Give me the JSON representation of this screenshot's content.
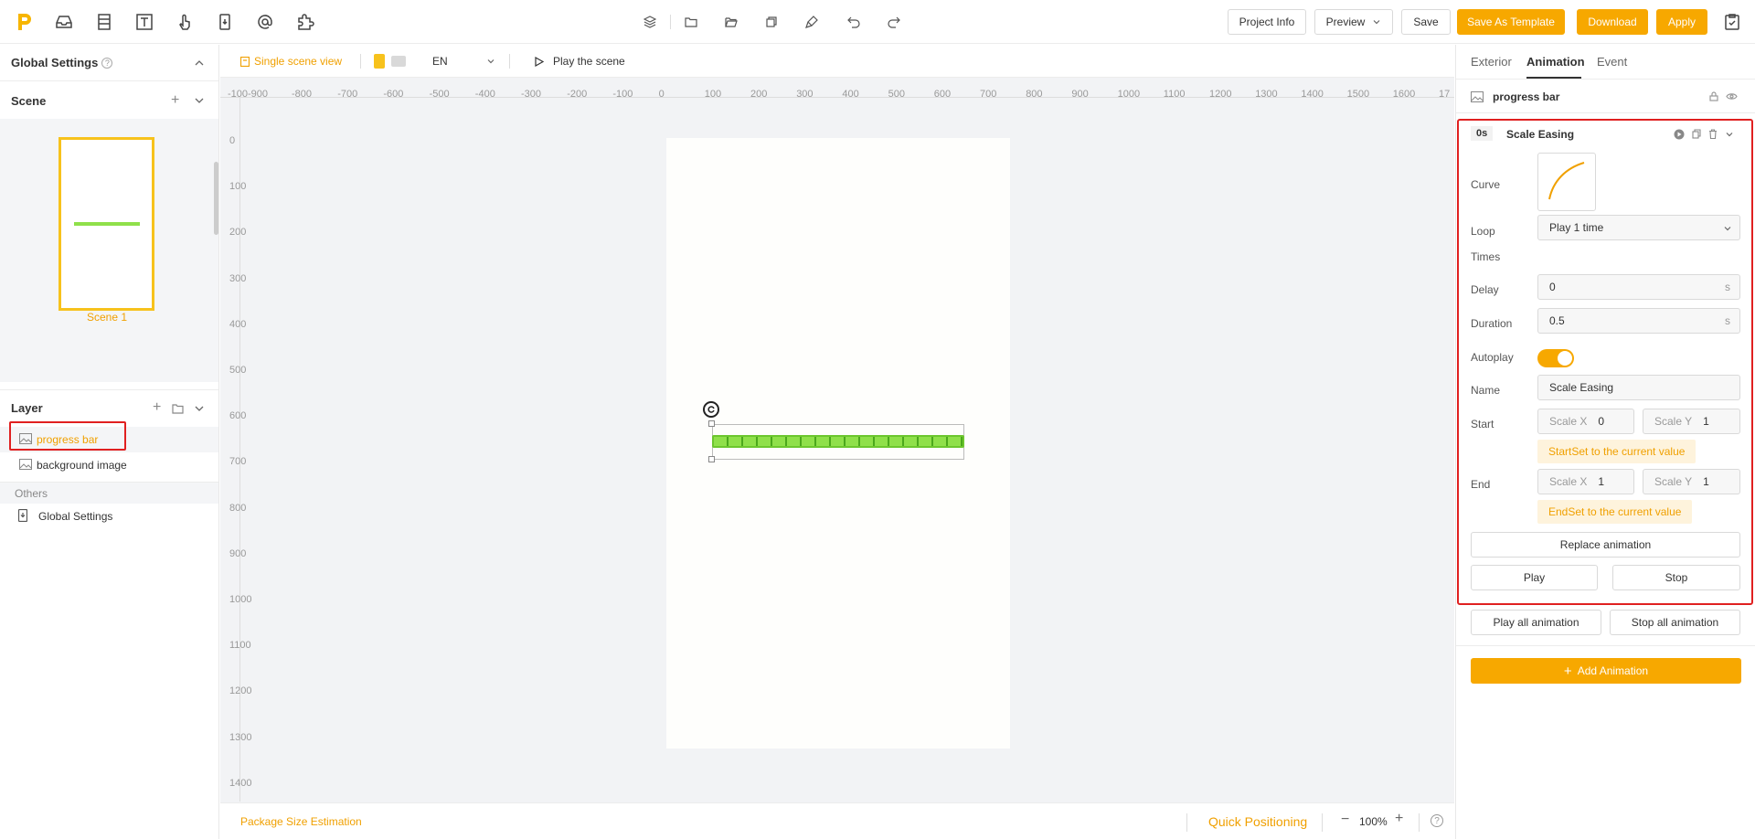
{
  "topbar": {
    "project_info": "Project Info",
    "preview": "Preview",
    "save": "Save",
    "save_template": "Save As Template",
    "download": "Download",
    "apply": "Apply"
  },
  "left": {
    "global_settings": "Global Settings",
    "scene_header": "Scene",
    "scene_name": "Scene 1",
    "layer_header": "Layer",
    "layers": [
      {
        "label": "progress bar",
        "selected": true
      },
      {
        "label": "background image",
        "selected": false
      }
    ],
    "others_header": "Others",
    "others_item": "Global Settings"
  },
  "canvas_toolbar": {
    "single_scene": "Single scene view",
    "language": "EN",
    "play_scene": "Play the scene"
  },
  "ruler": {
    "x_labels": [
      "-100",
      "-900",
      "-800",
      "-700",
      "-600",
      "-500",
      "-400",
      "-300",
      "-200",
      "-100",
      "0",
      "100",
      "200",
      "300",
      "400",
      "500",
      "600",
      "700",
      "800",
      "900",
      "1000",
      "1100",
      "1200",
      "1300",
      "1400",
      "1500",
      "1600",
      "17"
    ],
    "y_labels": [
      "0",
      "100",
      "200",
      "300",
      "400",
      "500",
      "600",
      "700",
      "800",
      "900",
      "1000",
      "1100",
      "1200",
      "1300",
      "1400"
    ]
  },
  "bottom": {
    "package_size": "Package Size Estimation",
    "quick_positioning": "Quick Positioning",
    "zoom": "100%"
  },
  "right": {
    "tabs": [
      "Exterior",
      "Animation",
      "Event"
    ],
    "active_tab": "Animation",
    "layer_name": "progress bar",
    "anim_time": "0s",
    "anim_title": "Scale Easing",
    "curve_label": "Curve",
    "loop_label": "Loop",
    "times_label": "Times",
    "loop_value": "Play 1 time",
    "delay_label": "Delay",
    "delay_value": "0",
    "delay_unit": "s",
    "duration_label": "Duration",
    "duration_value": "0.5",
    "duration_unit": "s",
    "autoplay_label": "Autoplay",
    "autoplay_on": true,
    "name_label": "Name",
    "name_value": "Scale Easing",
    "start_label": "Start",
    "start_scale_x_label": "Scale X",
    "start_scale_x": "0",
    "start_scale_y_label": "Scale Y",
    "start_scale_y": "1",
    "start_hint": "StartSet to the current value",
    "end_label": "End",
    "end_scale_x_label": "Scale X",
    "end_scale_x": "1",
    "end_scale_y_label": "Scale Y",
    "end_scale_y": "1",
    "end_hint": "EndSet to the current value",
    "replace_animation": "Replace animation",
    "play": "Play",
    "stop": "Stop",
    "play_all": "Play all animation",
    "stop_all": "Stop all animation",
    "add_animation": "Add Animation"
  },
  "colors": {
    "accent": "#f7a800",
    "highlight_border": "#e02020",
    "progress_green": "#8fe04a"
  }
}
